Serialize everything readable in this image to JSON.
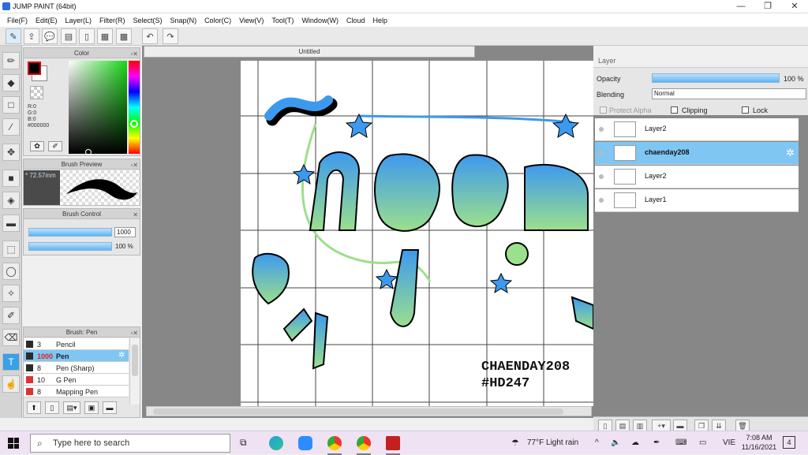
{
  "window": {
    "title": "JUMP PAINT (64bit)",
    "minimize": "—",
    "maximize": "❐",
    "close": "✕"
  },
  "menu": [
    "File(F)",
    "Edit(E)",
    "Layer(L)",
    "Filter(R)",
    "Select(S)",
    "Snap(N)",
    "Color(C)",
    "View(V)",
    "Tool(T)",
    "Window(W)",
    "Cloud",
    "Help"
  ],
  "toolbar": {
    "icons": [
      "brush-settings-icon",
      "share-icon",
      "comment-icon",
      "message-icon",
      "document-icon",
      "grid-icon",
      "tiles-icon"
    ],
    "undo_label": "↶",
    "redo_label": "↷"
  },
  "color_panel": {
    "title": "Color",
    "r": "R:0",
    "g": "G:0",
    "b": "B:0",
    "hex": "#000000",
    "foreground": "#000000",
    "background": "#ffffff"
  },
  "brush_preview": {
    "title": "Brush Preview",
    "size": "72.57mm"
  },
  "brush_control": {
    "title": "Brush Control",
    "size_value": "1000",
    "opacity_value": "100 %",
    "size_fraction": 1.0,
    "opacity_fraction": 1.0
  },
  "brush_list": {
    "title": "Brush: Pen",
    "items": [
      {
        "size": "3",
        "name": "Pencil",
        "color": "#2b2b2b",
        "selected": false
      },
      {
        "size": "1000",
        "name": "Pen",
        "color": "#2b2b2b",
        "selected": true
      },
      {
        "size": "8",
        "name": "Pen (Sharp)",
        "color": "#2b2b2b",
        "selected": false
      },
      {
        "size": "10",
        "name": "G Pen",
        "color": "#e03030",
        "selected": false
      },
      {
        "size": "8",
        "name": "Mapping Pen",
        "color": "#e03030",
        "selected": false
      }
    ]
  },
  "document": {
    "tab": "Untitled"
  },
  "artwork": {
    "word": "ngau",
    "tilde": "~",
    "credit_line1": "CHAENDAY208",
    "credit_line2": "#HD247",
    "gradient_top": "#3d99ee",
    "gradient_bottom": "#9be08c",
    "outline": "#000000"
  },
  "layer_panel": {
    "title": "Layer",
    "opacity_label": "Opacity",
    "opacity_value": "100 %",
    "opacity_fraction": 1.0,
    "blending_label": "Blending",
    "blending_value": "Normal",
    "protect_alpha": "Protect Alpha",
    "clipping": "Clipping",
    "lock": "Lock",
    "layers": [
      {
        "name": "Layer2",
        "selected": false
      },
      {
        "name": "chaenday208",
        "selected": true
      },
      {
        "name": "Layer2",
        "selected": false
      },
      {
        "name": "Layer1",
        "selected": false
      }
    ]
  },
  "taskbar": {
    "search_placeholder": "Type here to search",
    "weather": "77°F  Light rain",
    "lang": "VIE",
    "time": "7:08 AM",
    "date": "11/16/2021",
    "notifications": "4"
  }
}
